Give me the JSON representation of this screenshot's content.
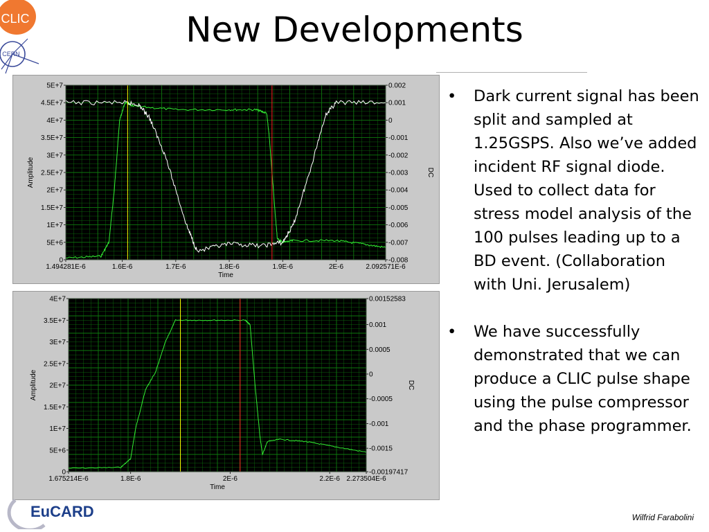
{
  "slide": {
    "title": "New Developments",
    "logos": {
      "clic": "CLIC",
      "cern": "CERN",
      "eucard": "EuCARD"
    },
    "footer": "Wilfrid Farabolini",
    "bullets": [
      "Dark current signal has been split and sampled at 1.25GSPS. Also we’ve added incident RF signal diode. Used to collect data for stress model analysis of the 100 pulses leading up to a BD event. (Collaboration with Uni. Jerusalem)",
      "We have successfully demonstrated that we can produce a CLIC pulse shape using the pulse compressor and the phase programmer."
    ]
  },
  "chart_data": [
    {
      "type": "line",
      "xlabel": "Time",
      "ylabel": "Amplitude",
      "y2label": "DC",
      "xlim": [
        1.494281e-06,
        2.092571e-06
      ],
      "ylim": [
        0,
        50000000.0
      ],
      "y2lim": [
        -0.008,
        0.002
      ],
      "x_ticks": [
        "1.494281E-6",
        "1.6E-6",
        "1.7E-6",
        "1.8E-6",
        "1.9E-6",
        "2E-6",
        "2.092571E-6"
      ],
      "y_ticks": [
        "5E+7",
        "4.5E+7",
        "4E+7",
        "3.5E+7",
        "3E+7",
        "2.5E+7",
        "2E+7",
        "1.5E+7",
        "1E+7",
        "5E+6",
        "0"
      ],
      "y2_ticks": [
        "0.002",
        "0.001",
        "0",
        "-0.001",
        "-0.002",
        "-0.003",
        "-0.004",
        "-0.005",
        "-0.006",
        "-0.007",
        "-0.008"
      ],
      "cursors": [
        1.61e-06,
        1.88e-06
      ],
      "colors": {
        "amplitude": "#33ee33",
        "dc": "#ffffff",
        "cursor1": "#ffff00",
        "cursor2": "#ff2020",
        "plot_bg": "#000000",
        "grid": "#0e7a0e"
      },
      "series": [
        {
          "name": "Amplitude",
          "x": [
            1.494281e-06,
            1.56e-06,
            1.575e-06,
            1.585e-06,
            1.595e-06,
            1.605e-06,
            1.62e-06,
            1.7e-06,
            1.8e-06,
            1.85e-06,
            1.87e-06,
            1.875e-06,
            1.885e-06,
            1.89e-06,
            1.9e-06,
            1.92e-06,
            2e-06,
            2.05e-06,
            2.092571e-06
          ],
          "values": [
            500000.0,
            1000000.0,
            5000000.0,
            20000000.0,
            40000000.0,
            45000000.0,
            44000000.0,
            43000000.0,
            43000000.0,
            43000000.0,
            42000000.0,
            35000000.0,
            15000000.0,
            6000000.0,
            5000000.0,
            5500000.0,
            5500000.0,
            4500000.0,
            3500000.0
          ]
        },
        {
          "name": "DC",
          "x": [
            1.494281e-06,
            1.6e-06,
            1.63e-06,
            1.65e-06,
            1.68e-06,
            1.72e-06,
            1.74e-06,
            1.8e-06,
            1.86e-06,
            1.9e-06,
            1.92e-06,
            1.95e-06,
            1.98e-06,
            2e-06,
            2.092571e-06
          ],
          "y2_values": [
            0.001,
            0.001,
            0.0009,
            0.0002,
            -0.002,
            -0.006,
            -0.0075,
            -0.0071,
            -0.0072,
            -0.007,
            -0.006,
            -0.003,
            0.0003,
            0.001,
            0.001
          ]
        }
      ]
    },
    {
      "type": "line",
      "xlabel": "Time",
      "ylabel": "Amplitude",
      "y2label": "DC",
      "xlim": [
        1.675214e-06,
        2.273504e-06
      ],
      "ylim": [
        0,
        40000000.0
      ],
      "y2lim": [
        -0.00197417,
        0.00152583
      ],
      "x_ticks": [
        "1.675214E-6",
        "1.8E-6",
        "2E-6",
        "2.2E-6",
        "2.273504E-6"
      ],
      "y_ticks": [
        "4E+7",
        "3.5E+7",
        "3E+7",
        "2.5E+7",
        "2E+7",
        "1.5E+7",
        "1E+7",
        "5E+6",
        "0"
      ],
      "y2_ticks": [
        "0.00152583",
        "0.001",
        "0.0005",
        "0",
        "-0.0005",
        "-0.001",
        "-0.0015",
        "-0.00197417"
      ],
      "cursors": [
        1.9e-06,
        2.02e-06
      ],
      "colors": {
        "amplitude": "#33ee33",
        "cursor1": "#ffff00",
        "cursor2": "#ff2020",
        "plot_bg": "#000000",
        "grid": "#0e7a0e"
      },
      "series": [
        {
          "name": "Amplitude",
          "x": [
            1.675214e-06,
            1.78e-06,
            1.8e-06,
            1.81e-06,
            1.83e-06,
            1.85e-06,
            1.87e-06,
            1.89e-06,
            1.95e-06,
            2.03e-06,
            2.04e-06,
            2.05e-06,
            2.06e-06,
            2.065e-06,
            2.075e-06,
            2.1e-06,
            2.15e-06,
            2.2e-06,
            2.273504e-06
          ],
          "values": [
            800000.0,
            1000000.0,
            3000000.0,
            10000000.0,
            19000000.0,
            23000000.0,
            30000000.0,
            35000000.0,
            35000000.0,
            35000000.0,
            34000000.0,
            20000000.0,
            8000000.0,
            4000000.0,
            7000000.0,
            7500000.0,
            7000000.0,
            6000000.0,
            4500000.0
          ]
        }
      ]
    }
  ]
}
